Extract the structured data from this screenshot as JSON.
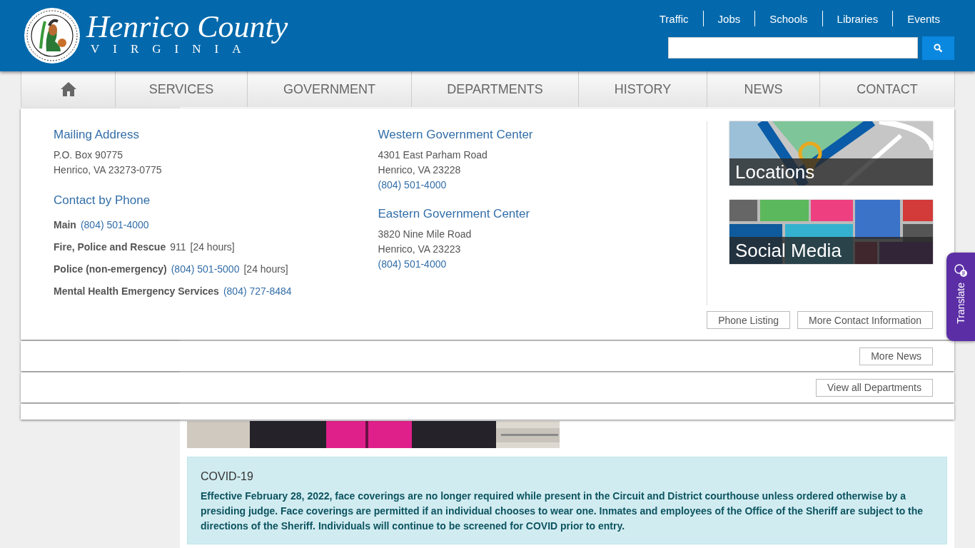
{
  "header": {
    "logo_title": "Henrico County",
    "logo_subtitle": "VIRGINIA",
    "top_links": [
      "Traffic",
      "Jobs",
      "Schools",
      "Libraries",
      "Events"
    ]
  },
  "nav": [
    {
      "kind": "home"
    },
    {
      "kind": "text",
      "label": "SERVICES"
    },
    {
      "kind": "text",
      "label": "GOVERNMENT"
    },
    {
      "kind": "text",
      "label": "DEPARTMENTS"
    },
    {
      "kind": "text",
      "label": "HISTORY"
    },
    {
      "kind": "text",
      "label": "NEWS"
    },
    {
      "kind": "text",
      "label": "CONTACT"
    }
  ],
  "contact_panel": {
    "mailing": {
      "heading": "Mailing Address",
      "lines": [
        "P.O. Box 90775",
        "Henrico, VA 23273-0775"
      ]
    },
    "phone": {
      "heading": "Contact by Phone",
      "entries": [
        {
          "label": "Main",
          "value": "(804) 501-4000",
          "link": true
        },
        {
          "label": "Fire, Police and Rescue",
          "value": "911",
          "link": false,
          "note": "[24 hours]"
        },
        {
          "label": "Police (non-emergency)",
          "value": "(804) 501-5000",
          "link": true,
          "note": "[24 hours]"
        },
        {
          "label": "Mental Health Emergency Services",
          "value": "(804) 727-8484",
          "link": true
        }
      ]
    },
    "centers": [
      {
        "heading": "Western Government Center",
        "lines": [
          "4301 East Parham Road",
          "Henrico, VA 23228"
        ],
        "phone": "(804) 501-4000"
      },
      {
        "heading": "Eastern Government Center",
        "lines": [
          "3820 Nine Mile Road",
          "Henrico, VA 23223"
        ],
        "phone": "(804) 501-4000"
      }
    ],
    "tiles": [
      {
        "kind": "map",
        "label": "Locations"
      },
      {
        "kind": "social",
        "label": "Social Media"
      }
    ],
    "buttons": [
      "Phone Listing",
      "More Contact Information"
    ]
  },
  "news_panel": {
    "button": "More News"
  },
  "departments_panel": {
    "button": "View all Departments"
  },
  "alert": {
    "title": "COVID-19",
    "body": "Effective February 28, 2022, face coverings are no longer required while present in the Circuit and District courthouse unless ordered otherwise by a presiding judge. Face coverings are permitted if an individual chooses to wear one. Inmates and employees of the Office of the Sheriff are subject to the directions of the Sheriff. Individuals will continue to be screened for COVID prior to entry."
  },
  "translate": {
    "label": "Translate"
  }
}
